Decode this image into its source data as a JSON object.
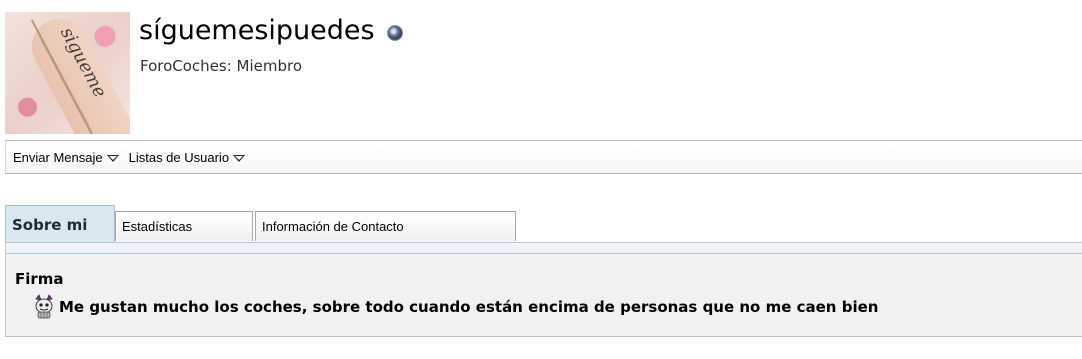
{
  "profile": {
    "username": "síguemesipuedes",
    "usertitle": "ForoCoches: Miembro",
    "avatar_tattoo_text": "sigueme",
    "status_icon": "online-status-icon"
  },
  "actions": [
    {
      "label": "Enviar Mensaje",
      "icon": "dropdown-arrow-icon"
    },
    {
      "label": "Listas de Usuario",
      "icon": "dropdown-arrow-icon"
    }
  ],
  "tabs": [
    {
      "label": "Sobre mi",
      "active": true
    },
    {
      "label": "Estadísticas",
      "active": false
    },
    {
      "label": "Información de Contacto",
      "active": false
    }
  ],
  "about": {
    "block_title": "Firma",
    "signature": "Me gustan mucho los coches, sobre todo cuando están encima de personas que no me caen bien",
    "signature_icon": "evil-smiley-icon"
  },
  "colors": {
    "active_tab_bg": "#d9e7ef",
    "panel_bg": "#f1f1f1",
    "border": "#a8a8a8"
  }
}
